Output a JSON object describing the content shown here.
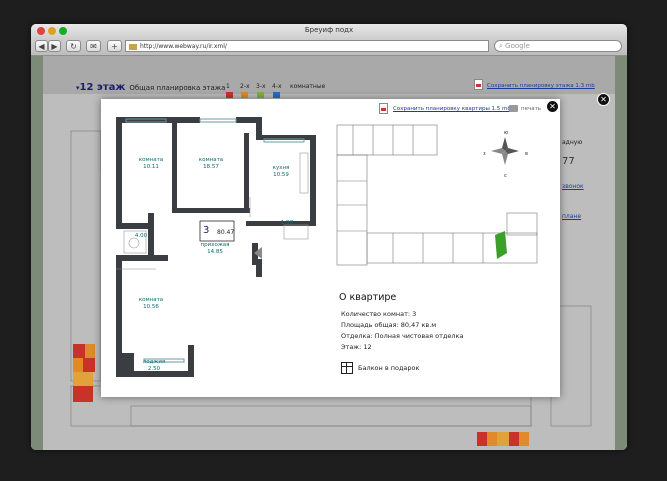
{
  "window": {
    "title": "Бреуиф подх"
  },
  "toolbar": {
    "url": "http://www.webway.ru/ir.xml/",
    "search_placeholder": "Google",
    "plus_label": "+"
  },
  "page": {
    "floor": "12 этаж",
    "floor_desc": "Общая планировка этажа",
    "room_counts": [
      "1",
      "2-х",
      "3-х",
      "4-х",
      "комнатные"
    ],
    "room_colors": [
      "#c8332a",
      "#e08a2a",
      "#7cb23a",
      "#2a6ac8"
    ],
    "download_link": "Сохранить планировку этажа 1.3 mb",
    "side_text_1": "адную",
    "side_text_2": "77",
    "side_text_3": "звонок",
    "side_text_4": "плане"
  },
  "modal": {
    "save_link": "Сохранить планировку квартиры 1.5 mb",
    "print_label": "печать",
    "heading": "О квартире",
    "info": [
      "Количество комнат: 3",
      "Площадь общая: 80,47 кв.м",
      "Отделка: Полная чистовая отделка",
      "Этаж: 12"
    ],
    "gift": "Балкон в подарок",
    "plan": {
      "room1": {
        "name": "комната",
        "area": "10.11"
      },
      "room2": {
        "name": "комната",
        "area": "18.57"
      },
      "kitchen": {
        "name": "кухня",
        "area": "10.59"
      },
      "bath": "4.00",
      "wc": "1.98",
      "hall": {
        "name": "прихожая",
        "area": "14.85"
      },
      "room3": {
        "name": "комната",
        "area": "10.56"
      },
      "loggia": {
        "name": "лоджия",
        "area": "2.50"
      },
      "apt_number": "3",
      "apt_area": "80.47"
    },
    "compass": {
      "n": "ю",
      "s": "с",
      "w": "з",
      "e": "в"
    }
  }
}
